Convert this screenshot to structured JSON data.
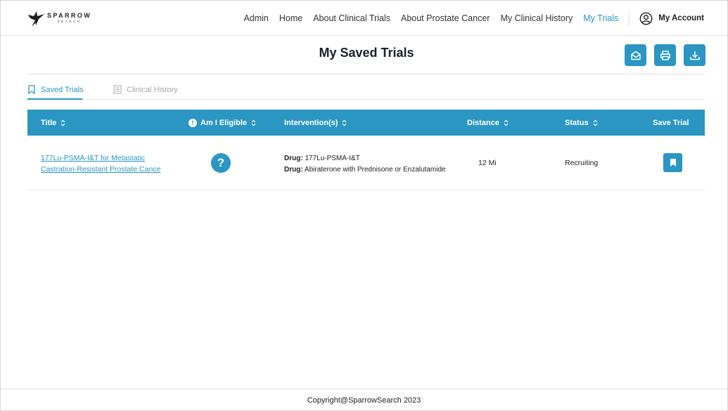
{
  "brand": {
    "name": "SPARROW",
    "sub": "SEARCH"
  },
  "nav": {
    "items": [
      "Admin",
      "Home",
      "About Clinical Trials",
      "About Prostate Cancer",
      "My Clinical History",
      "My Trials"
    ],
    "active": "My Trials",
    "account_label": "My Account"
  },
  "page": {
    "title": "My Saved Trials"
  },
  "tabs": [
    {
      "label": "Saved Trials",
      "active": true
    },
    {
      "label": "Clinical History",
      "active": false
    }
  ],
  "table": {
    "headers": {
      "title": "Title",
      "eligible": "Am I Eligible",
      "interventions": "Intervention(s)",
      "distance": "Distance",
      "status": "Status",
      "save": "Save Trial"
    },
    "rows": [
      {
        "title_line1": "177Lu-PSMA-I&T for Metastatic",
        "title_line2": "Castration-Resistant Prostate Cance",
        "eligible_symbol": "?",
        "interventions": [
          {
            "type": "Drug:",
            "name": "177Lu-PSMA-I&T"
          },
          {
            "type": "Drug:",
            "name": "Abiraterone with Prednisone or Enzalutamide"
          }
        ],
        "distance": "12 Mi",
        "status": "Recruiting",
        "saved": true
      }
    ]
  },
  "footer": {
    "copyright": "Copyright@SparrowSearch 2023"
  },
  "colors": {
    "accent": "#2b96c2",
    "link": "#2a96c4",
    "title": "#1a1f2c"
  },
  "icons": {
    "actions": [
      "envelope-open-icon",
      "printer-icon",
      "download-icon"
    ],
    "account": "user-circle-icon",
    "tab_saved": "bookmark-outline-icon",
    "tab_history": "list-document-icon",
    "save": "bookmark-filled-icon"
  }
}
